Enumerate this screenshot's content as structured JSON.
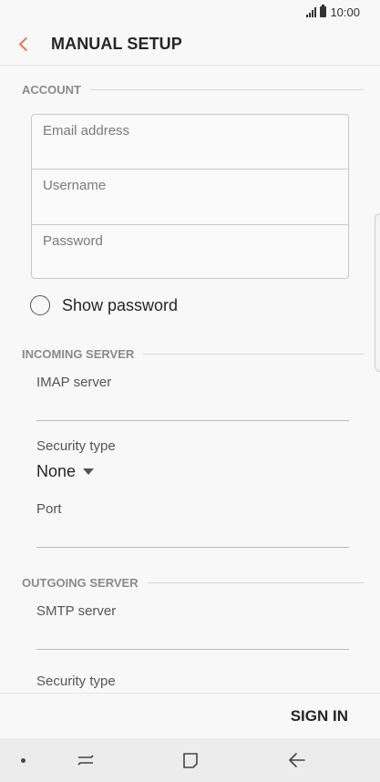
{
  "status_bar": {
    "time": "10:00"
  },
  "app_bar": {
    "title": "MANUAL SETUP"
  },
  "sections": {
    "account": "ACCOUNT",
    "incoming": "INCOMING SERVER",
    "outgoing": "OUTGOING SERVER"
  },
  "account": {
    "email_placeholder": "Email address",
    "username_placeholder": "Username",
    "password_placeholder": "Password",
    "show_password_label": "Show password"
  },
  "incoming": {
    "server_label": "IMAP server",
    "security_label": "Security type",
    "security_value": "None",
    "port_label": "Port"
  },
  "outgoing": {
    "server_label": "SMTP server",
    "security_label": "Security type"
  },
  "actions": {
    "sign_in": "SIGN IN"
  },
  "colors": {
    "accent": "#e8744a"
  }
}
